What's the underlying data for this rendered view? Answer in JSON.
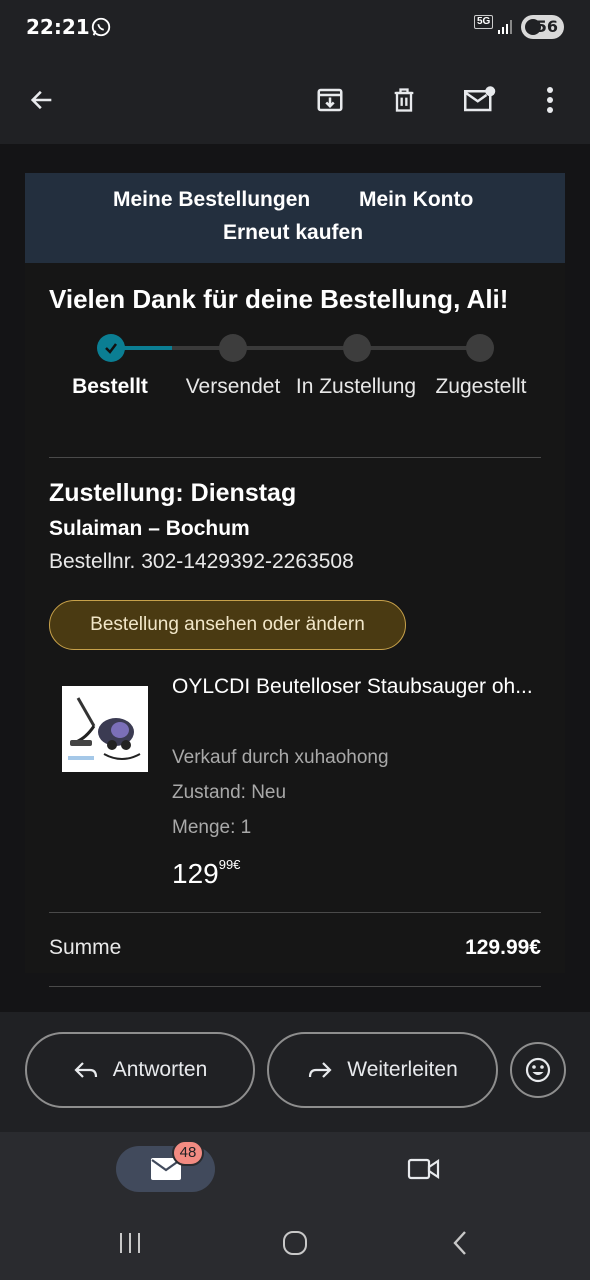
{
  "status_bar": {
    "time": "22:21",
    "network": "5G",
    "battery": "56",
    "icons": [
      "whatsapp-icon",
      "signal-icon",
      "battery-icon"
    ]
  },
  "toolbar": {
    "icons": [
      "back-arrow-icon",
      "archive-icon",
      "trash-icon",
      "mark-unread-icon",
      "more-vert-icon"
    ]
  },
  "email": {
    "nav_links": [
      "Meine Bestellungen",
      "Mein Konto",
      "Erneut kaufen"
    ],
    "thanks_title": "Vielen Dank für deine Bestellung, Ali!",
    "tracking": {
      "steps": [
        {
          "label": "Bestellt",
          "done": true
        },
        {
          "label": "Versendet",
          "done": false
        },
        {
          "label": "In Zustellung",
          "done": false
        },
        {
          "label": "Zugestellt",
          "done": false
        }
      ]
    },
    "delivery_title": "Zustellung: Dienstag",
    "delivery_name": "Sulaiman – Bochum",
    "order_number": "Bestellnr. 302-1429392-2263508",
    "view_order_button": "Bestellung ansehen oder ändern",
    "product": {
      "title": "OYLCDI Beutelloser Staubsauger oh...",
      "seller": "Verkauf durch xuhaohong",
      "condition": "Zustand: Neu",
      "quantity": "Menge: 1",
      "price_main": "129",
      "price_fraction": "99€"
    },
    "sum_label": "Summe",
    "sum_value": "129.99€"
  },
  "actions": {
    "reply_label": "Antworten",
    "forward_label": "Weiterleiten"
  },
  "bottom_nav": {
    "mail_badge": "48"
  },
  "colors": {
    "background": "#202124",
    "banner": "#232f3e",
    "tracking_accent": "#0b7e93",
    "button_border": "#c7a14a",
    "badge": "#f28b82"
  }
}
